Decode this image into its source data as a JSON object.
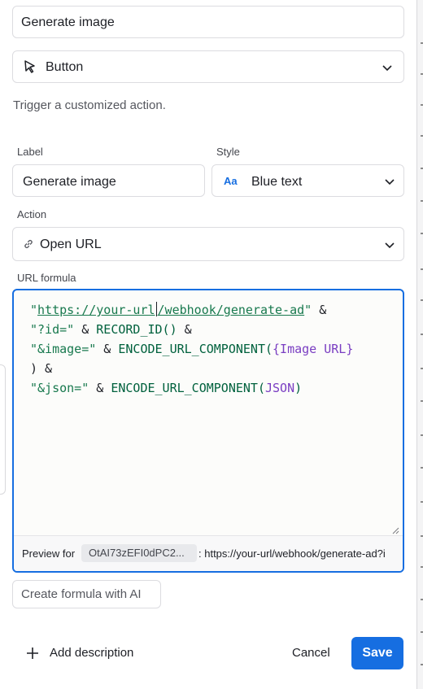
{
  "name_field": {
    "value": "Generate image"
  },
  "field_type": {
    "value": "Button",
    "icon": "cursor-icon"
  },
  "description": "Trigger a customized action.",
  "label_field": {
    "label": "Label",
    "value": "Generate image"
  },
  "style_field": {
    "label": "Style",
    "value": "Blue text",
    "icon_text": "Aa"
  },
  "action_field": {
    "label": "Action",
    "value": "Open URL",
    "icon": "link-icon"
  },
  "formula": {
    "label": "URL formula",
    "line1_q1": "\"",
    "line1_url_a": "https://your-url",
    "line1_url_b": "/webhook/generate-ad",
    "line1_q2": "\"",
    "line1_op": " &",
    "line2_str": "\"?id=\"",
    "line2_op": " & ",
    "line2_fn": "RECORD_ID()",
    "line2_end": " &",
    "line3_str": "\"&image=\"",
    "line3_op": " & ",
    "line3_fn": "ENCODE_URL_COMPONENT(",
    "line3_field": "{Image URL}",
    "line4": ") &",
    "line5_str": "\"&json=\"",
    "line5_op": " & ",
    "line5_fn": "ENCODE_URL_COMPONENT(",
    "line5_field": "JSON",
    "line5_close": ")"
  },
  "preview": {
    "label": "Preview for",
    "record": "OtAI73zEFI0dPC2...",
    "value": ": https://your-url/webhook/generate-ad?i"
  },
  "ai_button": "Create formula with AI",
  "footer": {
    "add_description": "Add description",
    "cancel": "Cancel",
    "save": "Save"
  },
  "colors": {
    "accent": "#166ee1",
    "string": "#18794e",
    "field": "#7a3ec2"
  }
}
